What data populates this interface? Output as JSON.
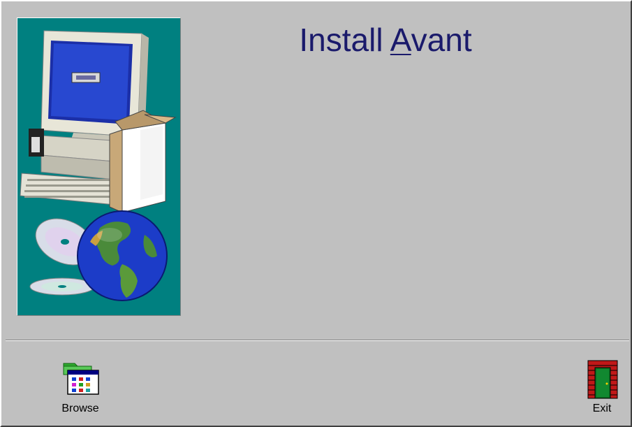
{
  "title": {
    "prefix": "Install ",
    "accelerator": "A",
    "suffix": "vant"
  },
  "buttons": {
    "browse_label": "Browse",
    "exit_label": "Exit"
  },
  "icons": {
    "browse": "folder-window-icon",
    "exit": "brick-doorway-exit-icon"
  },
  "colors": {
    "background": "#c0c0c0",
    "art_panel": "#008080",
    "title_text": "#1a1a6b"
  }
}
